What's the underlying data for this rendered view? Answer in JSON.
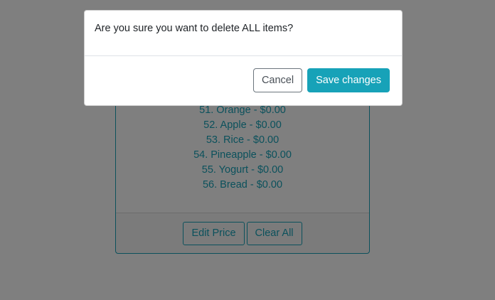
{
  "colors": {
    "accent": "#17a2b8",
    "backdrop": "rgba(0,0,0,0.5)",
    "cancel_border": "#6c757d"
  },
  "card": {
    "items": [
      "51. Orange - $0.00",
      "52. Apple - $0.00",
      "53. Rice - $0.00",
      "54. Pineapple - $0.00",
      "55. Yogurt - $0.00",
      "56. Bread - $0.00"
    ],
    "footer": {
      "edit_price_label": "Edit Price",
      "clear_all_label": "Clear All"
    }
  },
  "modal": {
    "message": "Are you sure you want to delete ALL items?",
    "cancel_label": "Cancel",
    "save_label": "Save changes"
  }
}
